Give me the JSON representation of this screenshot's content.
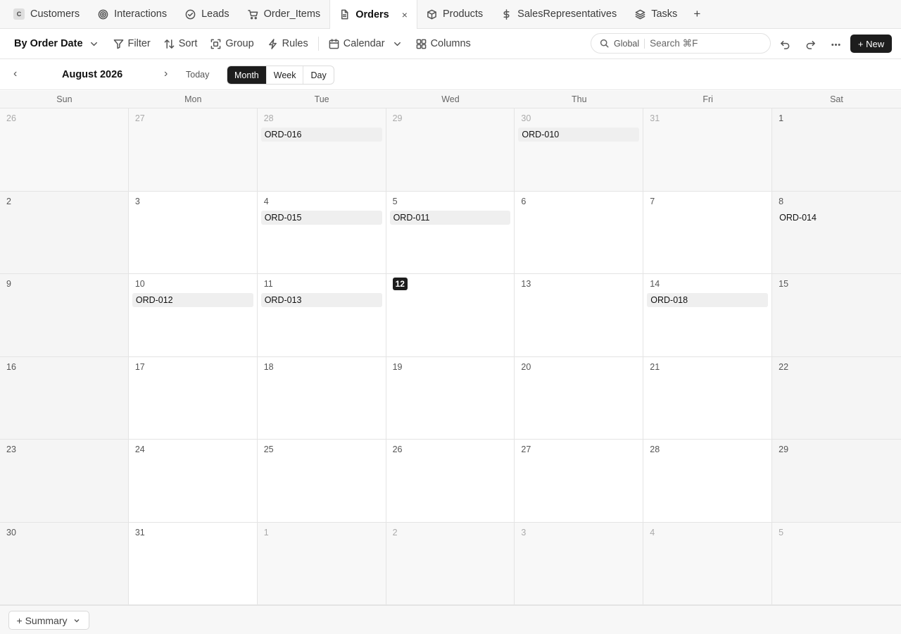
{
  "tabs": [
    {
      "label": "Customers",
      "icon": "customers-badge-icon",
      "badge": "C"
    },
    {
      "label": "Interactions",
      "icon": "target-icon"
    },
    {
      "label": "Leads",
      "icon": "check-circle-icon"
    },
    {
      "label": "Order_Items",
      "icon": "cart-icon"
    },
    {
      "label": "Orders",
      "icon": "document-icon",
      "active": true
    },
    {
      "label": "Products",
      "icon": "box-icon"
    },
    {
      "label": "SalesRepresentatives",
      "icon": "dollar-icon"
    },
    {
      "label": "Tasks",
      "icon": "layers-icon"
    }
  ],
  "tab_close": "×",
  "tab_add": "+",
  "toolbar": {
    "view_name": "By Order Date",
    "filter": "Filter",
    "sort": "Sort",
    "group": "Group",
    "rules": "Rules",
    "calendar": "Calendar",
    "columns": "Columns",
    "search_scope": "Global",
    "search_placeholder": "Search ⌘F",
    "new": "+ New"
  },
  "calendar": {
    "title": "August 2026",
    "prev": "‹",
    "next": "›",
    "today": "Today",
    "modes": [
      "Month",
      "Week",
      "Day"
    ],
    "active_mode": "Month",
    "weekdays": [
      "Sun",
      "Mon",
      "Tue",
      "Wed",
      "Thu",
      "Fri",
      "Sat"
    ],
    "today_date": 12,
    "weeks": [
      [
        {
          "d": 26,
          "o": true
        },
        {
          "d": 27,
          "o": true
        },
        {
          "d": 28,
          "o": true,
          "e": [
            "ORD-016"
          ]
        },
        {
          "d": 29,
          "o": true
        },
        {
          "d": 30,
          "o": true,
          "e": [
            "ORD-010"
          ]
        },
        {
          "d": 31,
          "o": true
        },
        {
          "d": 1
        }
      ],
      [
        {
          "d": 2
        },
        {
          "d": 3
        },
        {
          "d": 4,
          "e": [
            "ORD-015"
          ]
        },
        {
          "d": 5,
          "e": [
            "ORD-011"
          ]
        },
        {
          "d": 6
        },
        {
          "d": 7
        },
        {
          "d": 8,
          "e": [
            "ORD-014"
          ]
        }
      ],
      [
        {
          "d": 9
        },
        {
          "d": 10,
          "e": [
            "ORD-012"
          ]
        },
        {
          "d": 11,
          "e": [
            "ORD-013"
          ]
        },
        {
          "d": 12
        },
        {
          "d": 13
        },
        {
          "d": 14,
          "e": [
            "ORD-018"
          ]
        },
        {
          "d": 15
        }
      ],
      [
        {
          "d": 16
        },
        {
          "d": 17
        },
        {
          "d": 18
        },
        {
          "d": 19
        },
        {
          "d": 20
        },
        {
          "d": 21
        },
        {
          "d": 22
        }
      ],
      [
        {
          "d": 23
        },
        {
          "d": 24
        },
        {
          "d": 25
        },
        {
          "d": 26
        },
        {
          "d": 27
        },
        {
          "d": 28
        },
        {
          "d": 29
        }
      ],
      [
        {
          "d": 30
        },
        {
          "d": 31
        },
        {
          "d": 1,
          "o": true
        },
        {
          "d": 2,
          "o": true
        },
        {
          "d": 3,
          "o": true
        },
        {
          "d": 4,
          "o": true
        },
        {
          "d": 5,
          "o": true
        }
      ]
    ]
  },
  "footer": {
    "summary": "+ Summary"
  }
}
